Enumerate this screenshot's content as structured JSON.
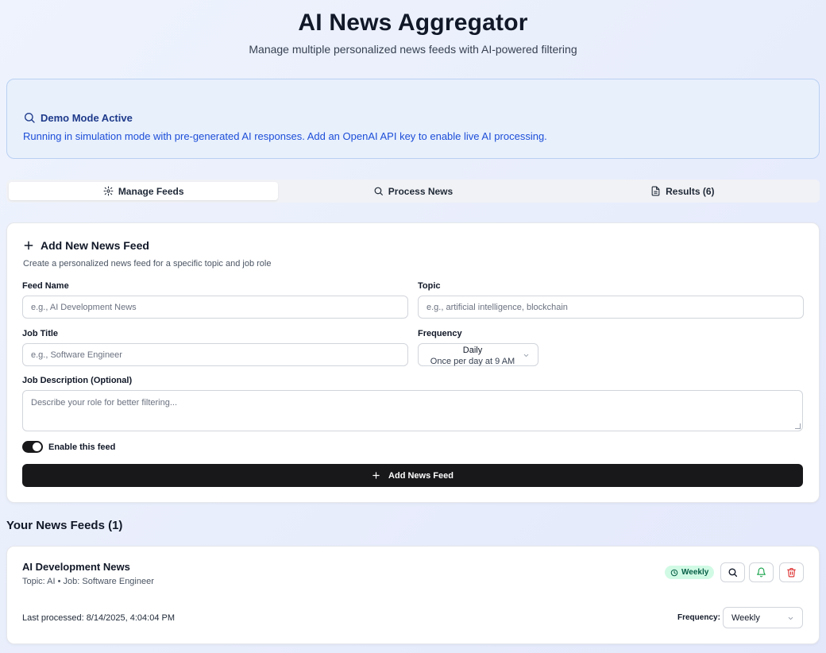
{
  "header": {
    "title": "AI News Aggregator",
    "subtitle": "Manage multiple personalized news feeds with AI-powered filtering"
  },
  "banner": {
    "title": "Demo Mode Active",
    "text": "Running in simulation mode with pre-generated AI responses. Add an OpenAI API key to enable live AI processing.",
    "icon": "search-icon"
  },
  "tabs": [
    {
      "label": "Manage Feeds",
      "icon": "gear-icon",
      "active": true
    },
    {
      "label": "Process News",
      "icon": "search-icon",
      "active": false
    },
    {
      "label": "Results (6)",
      "icon": "document-icon",
      "active": false
    }
  ],
  "form": {
    "title": "Add New News Feed",
    "description": "Create a personalized news feed for a specific topic and job role",
    "feed_name_label": "Feed Name",
    "feed_name_placeholder": "e.g., AI Development News",
    "topic_label": "Topic",
    "topic_placeholder": "e.g., artificial intelligence, blockchain",
    "job_title_label": "Job Title",
    "job_title_placeholder": "e.g., Software Engineer",
    "frequency_label": "Frequency",
    "frequency_value": "Daily",
    "frequency_sub": "Once per day at 9 AM",
    "job_desc_label": "Job Description (Optional)",
    "job_desc_placeholder": "Describe your role for better filtering...",
    "enable_label": "Enable this feed",
    "enabled": true,
    "submit_label": "Add News Feed"
  },
  "feeds_heading": "Your News Feeds (1)",
  "feeds": [
    {
      "name": "AI Development News",
      "meta": "Topic: AI • Job: Software Engineer",
      "badge": "Weekly",
      "last_processed": "Last processed: 8/14/2025, 4:04:04 PM",
      "frequency_label": "Frequency:",
      "frequency_value": "Weekly"
    }
  ],
  "colors": {
    "accent_dark": "#18181b",
    "banner_bg": "#e8f0fc",
    "banner_text": "#1d4ed8",
    "badge_bg": "#d1fae5",
    "badge_text": "#065f46",
    "bell_green": "#16a34a",
    "delete_red": "#dc2626"
  }
}
